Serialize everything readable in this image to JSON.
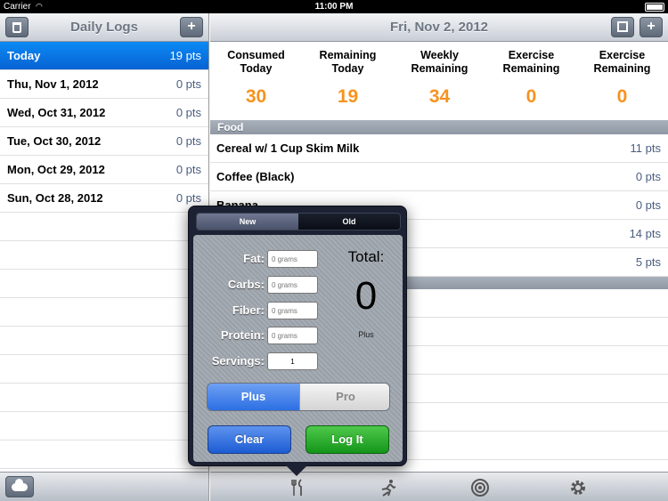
{
  "status": {
    "carrier": "Carrier",
    "time": "11:00 PM"
  },
  "left": {
    "title": "Daily Logs",
    "add_label": "+",
    "logs": [
      {
        "label": "Today",
        "pts": "19 pts"
      },
      {
        "label": "Thu, Nov 1, 2012",
        "pts": "0 pts"
      },
      {
        "label": "Wed, Oct 31, 2012",
        "pts": "0 pts"
      },
      {
        "label": "Tue, Oct 30, 2012",
        "pts": "0 pts"
      },
      {
        "label": "Mon, Oct 29, 2012",
        "pts": "0 pts"
      },
      {
        "label": "Sun, Oct 28, 2012",
        "pts": "0 pts"
      }
    ]
  },
  "right": {
    "title": "Fri, Nov 2, 2012",
    "add_label": "+",
    "summary": [
      {
        "label": "Consumed Today",
        "value": "30"
      },
      {
        "label": "Remaining Today",
        "value": "19"
      },
      {
        "label": "Weekly Remaining",
        "value": "34"
      },
      {
        "label": "Exercise Remaining",
        "value": "0"
      },
      {
        "label": "Exercise Remaining",
        "value": "0"
      }
    ],
    "section": "Food",
    "foods": [
      {
        "label": "Cereal w/ 1 Cup Skim Milk",
        "pts": "11 pts"
      },
      {
        "label": "Coffee (Black)",
        "pts": "0 pts"
      },
      {
        "label": "Banana",
        "pts": "0 pts"
      },
      {
        "label": "",
        "pts": "14 pts"
      },
      {
        "label": "",
        "pts": "5 pts"
      }
    ]
  },
  "popover": {
    "tabs": {
      "new": "New",
      "old": "Old"
    },
    "fields": {
      "fat": {
        "label": "Fat:",
        "placeholder": "0 grams"
      },
      "carbs": {
        "label": "Carbs:",
        "placeholder": "0 grams"
      },
      "fiber": {
        "label": "Fiber:",
        "placeholder": "0 grams"
      },
      "protein": {
        "label": "Protein:",
        "placeholder": "0 grams"
      },
      "servings": {
        "label": "Servings:",
        "value": "1"
      }
    },
    "total_label": "Total:",
    "total_value": "0",
    "total_type": "Plus",
    "mode": {
      "plus": "Plus",
      "pro": "Pro"
    },
    "clear": "Clear",
    "log_it": "Log It"
  },
  "colors": {
    "accent_orange": "#f7931e",
    "selected_blue": "#0b7ae9",
    "log_green": "#1fa324"
  },
  "icons": [
    "trash-icon",
    "add-icon",
    "edit-icon",
    "cloud-icon",
    "food-icon",
    "exercise-icon",
    "target-icon",
    "settings-icon"
  ]
}
